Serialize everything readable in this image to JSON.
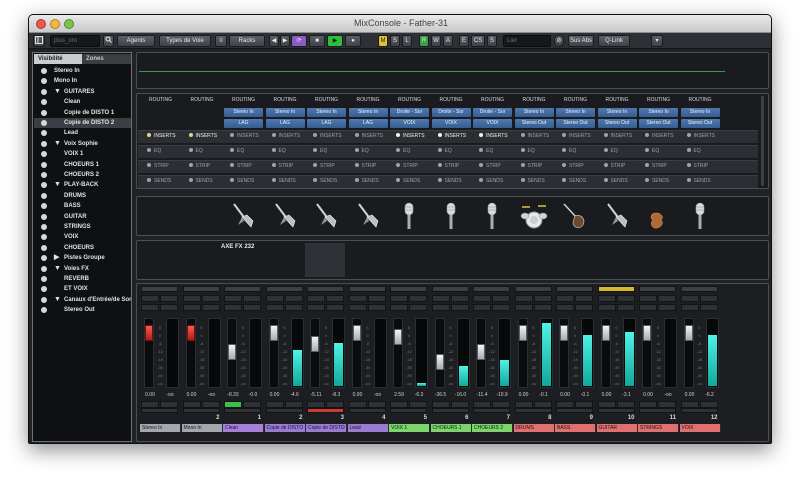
{
  "window": {
    "title": "MixConsole - Father-31"
  },
  "toolbar": {
    "search_placeholder": "plus_oro",
    "agents_label": "Agents",
    "channel_types_label": "Types de Voie",
    "racks_label": "Racks",
    "m_label": "M",
    "s_label": "S",
    "l_label": "L",
    "r_label": "R",
    "w_label": "W",
    "a_label": "A",
    "e_label": "E",
    "cs_label": "CS",
    "snap_label": "S",
    "link_field": "Lier",
    "sus_abs_label": "Sus Abs",
    "qlink_label": "Q-Link"
  },
  "sidebar": {
    "tab_visibility": "Visibilité",
    "tab_zones": "Zones",
    "items": [
      {
        "label": "Stereo In",
        "folder": false,
        "indent": 0
      },
      {
        "label": "Mono In",
        "folder": false,
        "indent": 0
      },
      {
        "label": "GUITARES",
        "folder": true,
        "indent": 0
      },
      {
        "label": "Clean",
        "folder": false,
        "indent": 1
      },
      {
        "label": "Copie de DISTO 1",
        "folder": false,
        "indent": 1
      },
      {
        "label": "Copie de DISTO 2",
        "folder": false,
        "indent": 1,
        "selected": true
      },
      {
        "label": "Lead",
        "folder": false,
        "indent": 1
      },
      {
        "label": "Voix Sophie",
        "folder": true,
        "indent": 0
      },
      {
        "label": "VOIX 1",
        "folder": false,
        "indent": 1
      },
      {
        "label": "CHOEURS 1",
        "folder": false,
        "indent": 1
      },
      {
        "label": "CHOEURS 2",
        "folder": false,
        "indent": 1
      },
      {
        "label": "PLAY-BACK",
        "folder": true,
        "indent": 0
      },
      {
        "label": "DRUMS",
        "folder": false,
        "indent": 1
      },
      {
        "label": "BASS",
        "folder": false,
        "indent": 1
      },
      {
        "label": "GUITAR",
        "folder": false,
        "indent": 1
      },
      {
        "label": "STRINGS",
        "folder": false,
        "indent": 1
      },
      {
        "label": "VOIX",
        "folder": false,
        "indent": 1
      },
      {
        "label": "CHOEURS",
        "folder": false,
        "indent": 1
      },
      {
        "label": "Pistes Groupe",
        "folder": true,
        "indent": 0,
        "collapsed": true
      },
      {
        "label": "Voies FX",
        "folder": true,
        "indent": 0
      },
      {
        "label": "REVERB",
        "folder": false,
        "indent": 1
      },
      {
        "label": "ET VOIX",
        "folder": false,
        "indent": 1
      },
      {
        "label": "Canaux d'Entrée/de Sor",
        "folder": true,
        "indent": 0
      },
      {
        "label": "Stereo Out",
        "folder": false,
        "indent": 1
      }
    ]
  },
  "routing": {
    "header": "ROUTING",
    "columns": [
      {
        "in": "",
        "out": ""
      },
      {
        "in": "",
        "out": ""
      },
      {
        "in": "Stereo In",
        "out": "LAG"
      },
      {
        "in": "Stereo In",
        "out": "LAG"
      },
      {
        "in": "Stereo In",
        "out": "LAG"
      },
      {
        "in": "Stereo In",
        "out": "LAG"
      },
      {
        "in": "Droite - Sor",
        "out": "VOIX"
      },
      {
        "in": "Droite - Sor",
        "out": "VOIX"
      },
      {
        "in": "Droite - Sor",
        "out": "VOIX"
      },
      {
        "in": "Stereo In",
        "out": "Stereo Out"
      },
      {
        "in": "Stereo In",
        "out": "Stereo Out"
      },
      {
        "in": "Stereo In",
        "out": "Stereo Out"
      },
      {
        "in": "Stereo In",
        "out": "Stereo Out"
      },
      {
        "in": "Stereo In",
        "out": "Stereo Out"
      }
    ]
  },
  "sections": {
    "inserts": "INSERTS",
    "eq": "EQ",
    "strip": "STRIP",
    "sends": "SENDS",
    "inserts_active": [
      0,
      1,
      6,
      7,
      8
    ]
  },
  "picture_label": "AXE FX 232",
  "instrument_icons": [
    "guitar-icon",
    "guitar-icon",
    "guitar-icon",
    "guitar-icon",
    "microphone-icon",
    "microphone-icon",
    "microphone-icon",
    "drum-kit-icon",
    "bass-guitar-icon",
    "guitar-icon",
    "violin-icon",
    "microphone-icon"
  ],
  "channels": [
    {
      "number": "",
      "name": "Stereo In",
      "color": "#a2a8ae",
      "volume": "0.00",
      "peak": "-oo",
      "level": 0,
      "fader": 0.92,
      "red": true
    },
    {
      "number": "2",
      "name": "Mono In",
      "color": "#a2a8ae",
      "volume": "0.00",
      "peak": "-oo",
      "level": 0,
      "fader": 0.92,
      "red": true
    },
    {
      "number": "1",
      "name": "Clean",
      "color": "#a77ed8",
      "volume": "-8.33",
      "peak": "-0.0",
      "level": 0,
      "fader": 0.55
    },
    {
      "number": "2",
      "name": "Copie de DISTO 1",
      "color": "#9a7bd4",
      "volume": "0.00",
      "peak": "-4.6",
      "level": 0.55,
      "fader": 0.92
    },
    {
      "number": "3",
      "name": "Copie de DISTO 2",
      "color": "#9a7bd4",
      "volume": "-5.11",
      "peak": "-8.3",
      "level": 0.65,
      "fader": 0.7
    },
    {
      "number": "4",
      "name": "Lead",
      "color": "#9a7bd4",
      "volume": "0.00",
      "peak": "-oo",
      "level": 0,
      "fader": 0.92
    },
    {
      "number": "5",
      "name": "VOIX 1",
      "color": "#7cd46a",
      "volume": "2.59",
      "peak": "-6.3",
      "level": 0.05,
      "fader": 0.85
    },
    {
      "number": "6",
      "name": "CHOEURS 1",
      "color": "#7cd46a",
      "volume": "-36.5",
      "peak": "-16.0",
      "level": 0.3,
      "fader": 0.35
    },
    {
      "number": "7",
      "name": "CHOEURS 2",
      "color": "#7cd46a",
      "volume": "-11.4",
      "peak": "-10.9",
      "level": 0.4,
      "fader": 0.55
    },
    {
      "number": "8",
      "name": "DRUMS",
      "color": "#e06f6f",
      "volume": "0.00",
      "peak": "-0.1",
      "level": 0.95,
      "fader": 0.92
    },
    {
      "number": "9",
      "name": "BASS",
      "color": "#e06f6f",
      "volume": "0.00",
      "peak": "-0.1",
      "level": 0.78,
      "fader": 0.92
    },
    {
      "number": "10",
      "name": "GUITAR",
      "color": "#e06f6f",
      "volume": "0.00",
      "peak": "-3.1",
      "level": 0.82,
      "fader": 0.92,
      "yellow": true
    },
    {
      "number": "11",
      "name": "STRINGS",
      "color": "#e06f6f",
      "volume": "0.00",
      "peak": "-oo",
      "level": 0,
      "fader": 0.92
    },
    {
      "number": "12",
      "name": "VOIX",
      "color": "#e06f6f",
      "volume": "0.00",
      "peak": "-6.2",
      "level": 0.78,
      "fader": 0.92
    }
  ],
  "scale_ticks": [
    "6",
    "0",
    "-6",
    "-12",
    "-18",
    "-30",
    "-40",
    "-oo"
  ],
  "colors": {
    "meter": "#33e3d6",
    "routing_button": "#466f9f",
    "accent_green": "#2fbf3a"
  }
}
